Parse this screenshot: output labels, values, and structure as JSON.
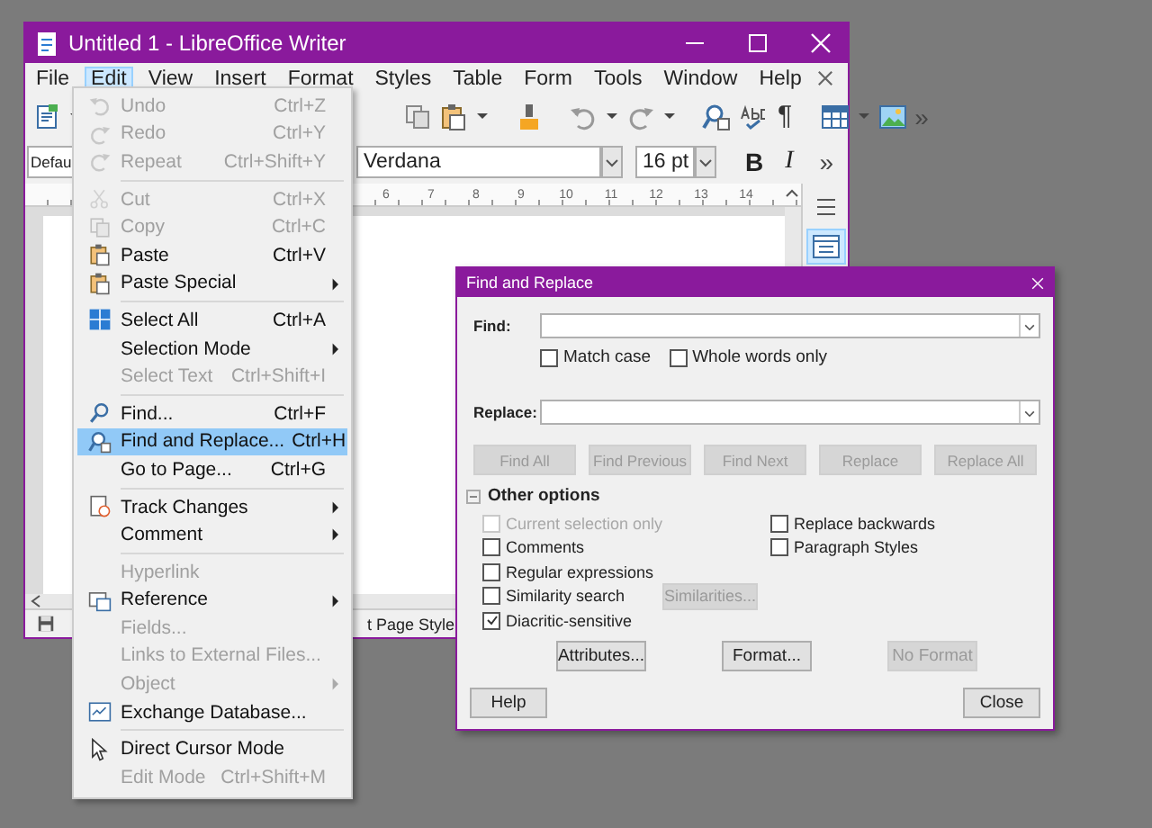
{
  "window": {
    "title": "Untitled 1 - LibreOffice Writer"
  },
  "menu_bar": [
    {
      "label": "File",
      "selected": false
    },
    {
      "label": "Edit",
      "selected": true
    },
    {
      "label": "View",
      "selected": false
    },
    {
      "label": "Insert",
      "selected": false
    },
    {
      "label": "Format",
      "selected": false
    },
    {
      "label": "Styles",
      "selected": false
    },
    {
      "label": "Table",
      "selected": false
    },
    {
      "label": "Form",
      "selected": false
    },
    {
      "label": "Tools",
      "selected": false
    },
    {
      "label": "Window",
      "selected": false
    },
    {
      "label": "Help",
      "selected": false
    }
  ],
  "standard_toolbar": {
    "formatting_marks": "¶",
    "more": "»"
  },
  "formatting_toolbar": {
    "paragraph_style": "Defau",
    "font_name": "Verdana",
    "font_size": "16 pt",
    "bold": "B",
    "italic": "I",
    "more": "»"
  },
  "ruler_numbers": [
    "6",
    "7",
    "8",
    "9",
    "10",
    "11",
    "12",
    "13",
    "14"
  ],
  "status_bar": {
    "page_style": "t Page Style"
  },
  "edit_menu": [
    {
      "kind": "item",
      "label": "Undo",
      "shortcut": "Ctrl+Z",
      "disabled": true,
      "selected": false,
      "submenu": false
    },
    {
      "kind": "item",
      "label": "Redo",
      "shortcut": "Ctrl+Y",
      "disabled": true,
      "selected": false,
      "submenu": false
    },
    {
      "kind": "item",
      "label": "Repeat",
      "shortcut": "Ctrl+Shift+Y",
      "disabled": true,
      "selected": false,
      "submenu": false
    },
    {
      "kind": "separator"
    },
    {
      "kind": "item",
      "label": "Cut",
      "shortcut": "Ctrl+X",
      "disabled": true,
      "selected": false,
      "submenu": false
    },
    {
      "kind": "item",
      "label": "Copy",
      "shortcut": "Ctrl+C",
      "disabled": true,
      "selected": false,
      "submenu": false
    },
    {
      "kind": "item",
      "label": "Paste",
      "shortcut": "Ctrl+V",
      "disabled": false,
      "selected": false,
      "submenu": false
    },
    {
      "kind": "item",
      "label": "Paste Special",
      "disabled": false,
      "selected": false,
      "submenu": true
    },
    {
      "kind": "separator"
    },
    {
      "kind": "item",
      "label": "Select All",
      "shortcut": "Ctrl+A",
      "disabled": false,
      "selected": false,
      "submenu": false
    },
    {
      "kind": "item",
      "label": "Selection Mode",
      "disabled": false,
      "selected": false,
      "submenu": true
    },
    {
      "kind": "item",
      "label": "Select Text",
      "shortcut": "Ctrl+Shift+I",
      "disabled": true,
      "selected": false,
      "submenu": false
    },
    {
      "kind": "separator"
    },
    {
      "kind": "item",
      "label": "Find...",
      "shortcut": "Ctrl+F",
      "disabled": false,
      "selected": false,
      "submenu": false
    },
    {
      "kind": "item",
      "label": "Find and Replace...",
      "shortcut": "Ctrl+H",
      "disabled": false,
      "selected": true,
      "submenu": false
    },
    {
      "kind": "item",
      "label": "Go to Page...",
      "shortcut": "Ctrl+G",
      "disabled": false,
      "selected": false,
      "submenu": false
    },
    {
      "kind": "separator"
    },
    {
      "kind": "item",
      "label": "Track Changes",
      "disabled": false,
      "selected": false,
      "submenu": true
    },
    {
      "kind": "item",
      "label": "Comment",
      "disabled": false,
      "selected": false,
      "submenu": true
    },
    {
      "kind": "separator"
    },
    {
      "kind": "item",
      "label": "Hyperlink",
      "disabled": true,
      "selected": false,
      "submenu": false
    },
    {
      "kind": "item",
      "label": "Reference",
      "disabled": false,
      "selected": false,
      "submenu": true
    },
    {
      "kind": "item",
      "label": "Fields...",
      "disabled": true,
      "selected": false,
      "submenu": false
    },
    {
      "kind": "item",
      "label": "Links to External Files...",
      "disabled": true,
      "selected": false,
      "submenu": false
    },
    {
      "kind": "item",
      "label": "Object",
      "disabled": true,
      "selected": false,
      "submenu": true
    },
    {
      "kind": "item",
      "label": "Exchange Database...",
      "disabled": false,
      "selected": false,
      "submenu": false
    },
    {
      "kind": "separator"
    },
    {
      "kind": "item",
      "label": "Direct Cursor Mode",
      "disabled": false,
      "selected": false,
      "submenu": false
    },
    {
      "kind": "item",
      "label": "Edit Mode",
      "shortcut": "Ctrl+Shift+M",
      "disabled": true,
      "selected": false,
      "submenu": false
    }
  ],
  "find_replace_dialog": {
    "title": "Find and Replace",
    "find": {
      "label": "Find:"
    },
    "find_options": [
      {
        "label": "Match case",
        "checked": false
      },
      {
        "label": "Whole words only",
        "checked": false
      }
    ],
    "replace": {
      "label": "Replace:"
    },
    "actions": [
      {
        "label": "Find All",
        "disabled": true
      },
      {
        "label": "Find Previous",
        "disabled": true
      },
      {
        "label": "Find Next",
        "disabled": true
      },
      {
        "label": "Replace",
        "disabled": true
      },
      {
        "label": "Replace All",
        "disabled": true
      }
    ],
    "other_options": {
      "label": "Other options",
      "expanded": true,
      "rows": [
        [
          {
            "kind": "checkbox",
            "label": "Current selection only",
            "checked": false,
            "disabled": true
          },
          {
            "kind": "checkbox",
            "label": "Replace backwards",
            "checked": false,
            "disabled": false
          }
        ],
        [
          {
            "kind": "checkbox",
            "label": "Comments",
            "checked": false,
            "disabled": false
          },
          {
            "kind": "checkbox",
            "label": "Paragraph Styles",
            "checked": false,
            "disabled": false
          }
        ],
        [
          {
            "kind": "checkbox",
            "label": "Regular expressions",
            "checked": false,
            "disabled": false
          }
        ],
        [
          {
            "kind": "checkbox",
            "label": "Similarity search",
            "checked": false,
            "disabled": false
          },
          {
            "kind": "button",
            "label": "Similarities...",
            "disabled": true
          }
        ],
        [
          {
            "kind": "checkbox",
            "label": "Diacritic-sensitive",
            "checked": true,
            "disabled": false
          }
        ]
      ],
      "buttons": [
        {
          "label": "Attributes...",
          "disabled": false
        },
        {
          "label": "Format...",
          "disabled": false
        },
        {
          "label": "No Format",
          "disabled": true
        }
      ]
    },
    "footer_buttons": [
      {
        "label": "Help"
      },
      {
        "label": "Close"
      }
    ]
  }
}
